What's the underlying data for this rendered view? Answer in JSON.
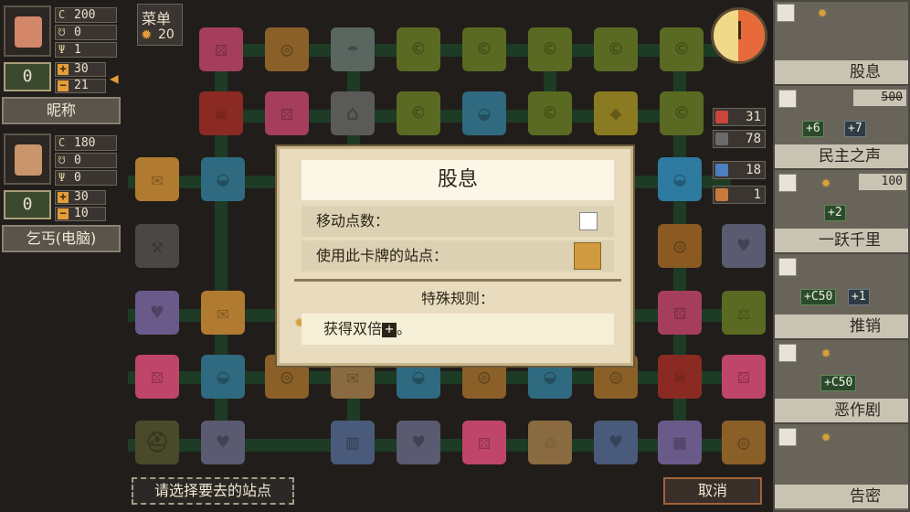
{
  "menu": {
    "label": "菜单",
    "count": "20"
  },
  "players": [
    {
      "money": "200",
      "stat2": "0",
      "stat3": "1",
      "score": "0",
      "plus": "30",
      "minus": "21",
      "name": "昵称"
    },
    {
      "money": "180",
      "stat2": "0",
      "stat3": "0",
      "score": "0",
      "plus": "30",
      "minus": "10",
      "name": "乞丐(电脑)"
    }
  ],
  "counters": [
    {
      "value": "31",
      "color": "#c8463c"
    },
    {
      "value": "78",
      "color": "#6b6b6b"
    },
    {
      "value": "18",
      "color": "#4a7fc0"
    },
    {
      "value": "1",
      "color": "#c87a3a"
    }
  ],
  "dialog": {
    "title": "股息",
    "move_label": "移动点数：",
    "station_label": "使用此卡牌的站点：",
    "special_label": "特殊规则：",
    "rule_text": "获得双倍",
    "rule_suffix": "。"
  },
  "cards": [
    {
      "title": "股息"
    },
    {
      "title": "民主之声",
      "price": "500",
      "pill1": "+6",
      "pill2": "+7"
    },
    {
      "title": "一跃千里",
      "price": "100",
      "pill1": "+2"
    },
    {
      "title": "推销",
      "pill1": "+C50",
      "pill2": "+1"
    },
    {
      "title": "恶作剧",
      "pill1": "+C50"
    },
    {
      "title": "告密"
    }
  ],
  "bottom": {
    "prompt": "请选择要去的站点",
    "cancel": "取消"
  },
  "colors": {
    "accent": "#e59d3a",
    "track": "#1d3b25"
  }
}
